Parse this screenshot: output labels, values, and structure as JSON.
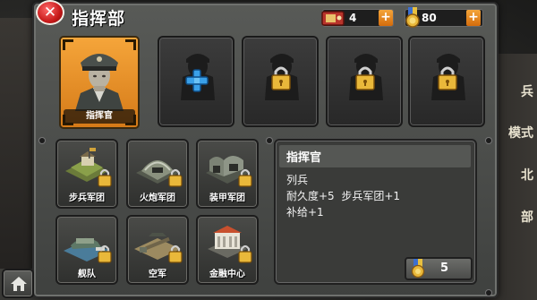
{
  "header": {
    "title": "指挥部",
    "close_icon": "close-icon"
  },
  "resources": {
    "ticket": {
      "icon": "ticket-icon",
      "value": "4"
    },
    "medal": {
      "icon": "medal-icon",
      "value": "80"
    },
    "plus_label": "+"
  },
  "commander": {
    "label": "指挥官",
    "icon": "general-portrait"
  },
  "slots": [
    {
      "state": "add",
      "icon": "plus-icon"
    },
    {
      "state": "locked",
      "icon": "lock-icon"
    },
    {
      "state": "locked",
      "icon": "lock-icon"
    },
    {
      "state": "locked",
      "icon": "lock-icon"
    }
  ],
  "branches": [
    {
      "label": "步兵军团",
      "icon": "infantry-barracks-icon",
      "locked": true
    },
    {
      "label": "火炮军团",
      "icon": "artillery-bunker-icon",
      "locked": true
    },
    {
      "label": "装甲军团",
      "icon": "armor-hangar-icon",
      "locked": true
    },
    {
      "label": "舰队",
      "icon": "naval-dock-icon",
      "locked": true
    },
    {
      "label": "空军",
      "icon": "airfield-icon",
      "locked": true
    },
    {
      "label": "金融中心",
      "icon": "bank-building-icon",
      "locked": true
    }
  ],
  "info": {
    "title": "指挥官",
    "lines": [
      "列兵",
      "耐久度+5  步兵军团+1",
      "补给+1"
    ]
  },
  "cost": {
    "icon": "medal-icon",
    "value": "5"
  },
  "home": {
    "icon": "home-icon"
  },
  "background_side_text": [
    "兵",
    "模式",
    "北",
    "部"
  ],
  "colors": {
    "accent_orange": "#e8891f",
    "frame": "#4d4f4c",
    "close_red": "#c71a1a",
    "plus_blue": "#3aa0e8",
    "gold": "#e9b83a"
  }
}
